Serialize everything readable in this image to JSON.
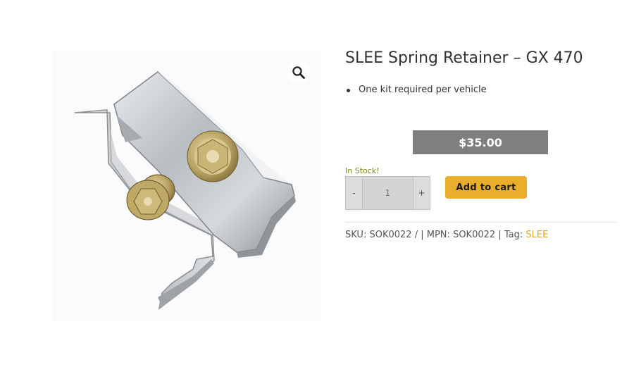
{
  "product": {
    "title": "SLEE Spring Retainer – GX 470",
    "short_description": [
      "One kit required per vehicle"
    ],
    "price": "$35.00",
    "stock_status": "In Stock!",
    "image_icon": "search-icon"
  },
  "quantity": {
    "minus_label": "-",
    "value": "1",
    "plus_label": "+"
  },
  "add_to_cart_label": "Add to cart",
  "meta": {
    "sku_label": "SKU:",
    "sku_value": "SOK0022",
    "sku_suffix": "/ |",
    "mpn_label": "MPN:",
    "mpn_value": "SOK0022",
    "separator": "|",
    "tag_label": "Tag:",
    "tag_value": "SLEE"
  },
  "colors": {
    "price_background": "#7f7f7f",
    "stock_text": "#7a8a14",
    "button_background": "#e8ae2c",
    "tag_link": "#e0a42a"
  }
}
